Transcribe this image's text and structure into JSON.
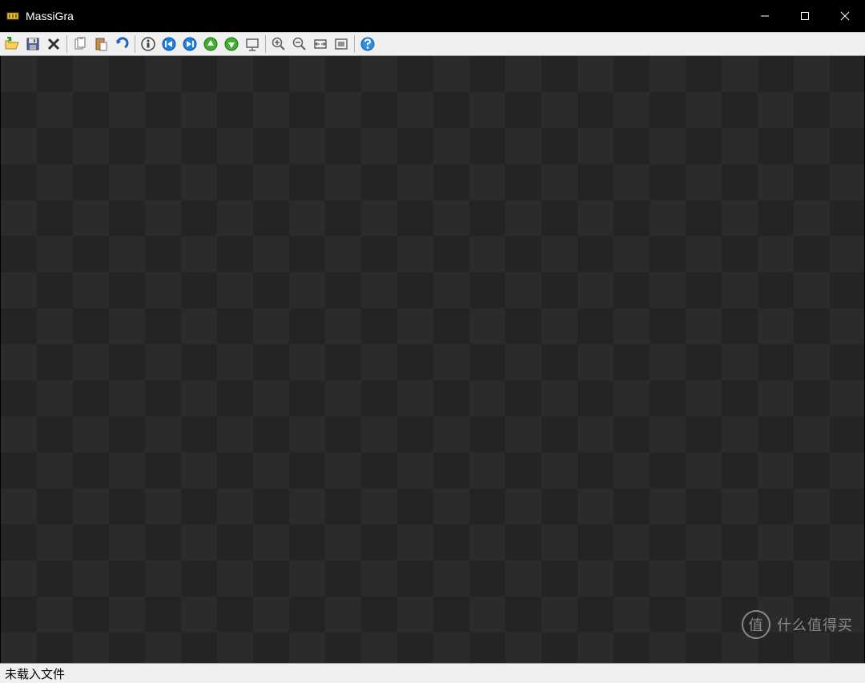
{
  "titlebar": {
    "app_name": "MassiGra"
  },
  "toolbar": {
    "open": "Open",
    "save": "Save",
    "delete": "Delete",
    "copy": "Copy",
    "paste": "Paste",
    "undo": "Undo",
    "info": "Info",
    "first": "First",
    "last": "Last",
    "prev": "Previous",
    "next": "Next",
    "slideshow": "Slideshow",
    "zoom_in": "Zoom In",
    "zoom_out": "Zoom Out",
    "fit_width": "Fit Width",
    "fit_window": "Fit Window",
    "help": "Help"
  },
  "statusbar": {
    "message": "未载入文件"
  },
  "watermark": {
    "badge": "值",
    "text": "什么值得买"
  },
  "colors": {
    "titlebar_bg": "#000000",
    "toolbar_bg": "#f0f0f0",
    "canvas_dark": "#242424",
    "canvas_light": "#2b2b2b"
  }
}
